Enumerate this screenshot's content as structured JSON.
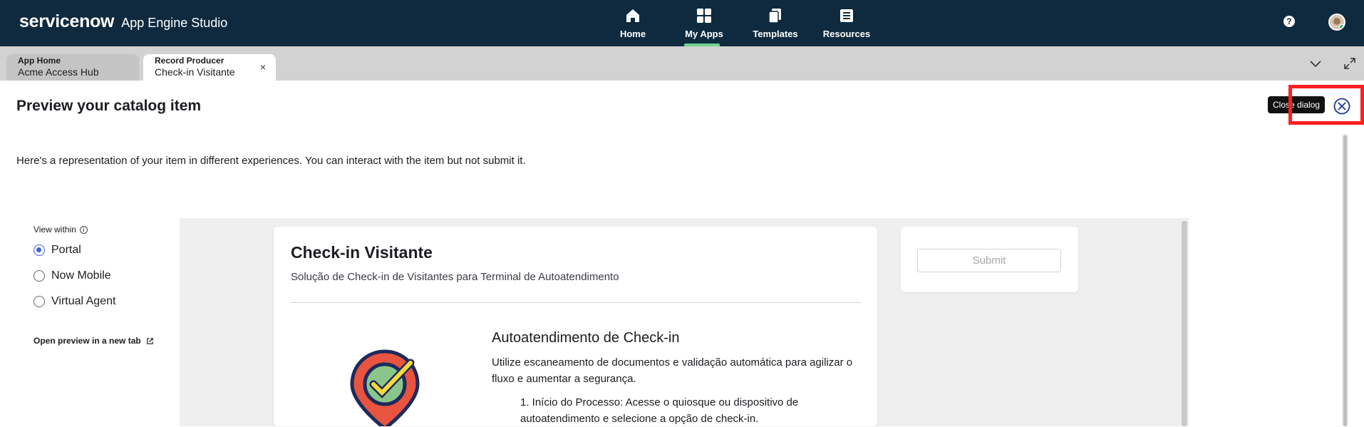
{
  "header": {
    "brand": "servicenow",
    "app_name": "App Engine Studio",
    "nav": [
      {
        "label": "Home",
        "icon": "home-icon",
        "active": false
      },
      {
        "label": "My Apps",
        "icon": "apps-grid-icon",
        "active": true
      },
      {
        "label": "Templates",
        "icon": "templates-icon",
        "active": false
      },
      {
        "label": "Resources",
        "icon": "resources-icon",
        "active": false
      }
    ],
    "help_glyph": "?",
    "colors": {
      "background": "#0f2a3f",
      "active_underline": "#6fd38b"
    }
  },
  "tabs": [
    {
      "small": "App Home",
      "label": "Acme Access Hub",
      "active": false
    },
    {
      "small": "Record Producer",
      "label": "Check-in Visitante",
      "active": true,
      "close_glyph": "×"
    }
  ],
  "dialog": {
    "title": "Preview your catalog item",
    "close_tooltip": "Close dialog",
    "description": "Here's a representation of your item in different experiences. You can interact with the item but not submit it."
  },
  "view_within": {
    "label": "View within",
    "info_glyph": "i",
    "options": [
      {
        "label": "Portal",
        "checked": true
      },
      {
        "label": "Now Mobile",
        "checked": false
      },
      {
        "label": "Virtual Agent",
        "checked": false
      }
    ],
    "open_link": "Open preview in a new tab"
  },
  "preview": {
    "title": "Check-in Visitante",
    "subtitle": "Solução de Check-in de Visitantes para Terminal de Autoatendimento",
    "section_title": "Autoatendimento de Check-in",
    "section_text": "Utilize escaneamento de documentos e validação automática para agilizar o fluxo e aumentar a segurança.",
    "step_1": "1. Início do Processo: Acesse o quiosque ou dispositivo de autoatendimento e selecione a opção de check-in.",
    "submit_label": "Submit",
    "accent": "#3b64d8"
  }
}
